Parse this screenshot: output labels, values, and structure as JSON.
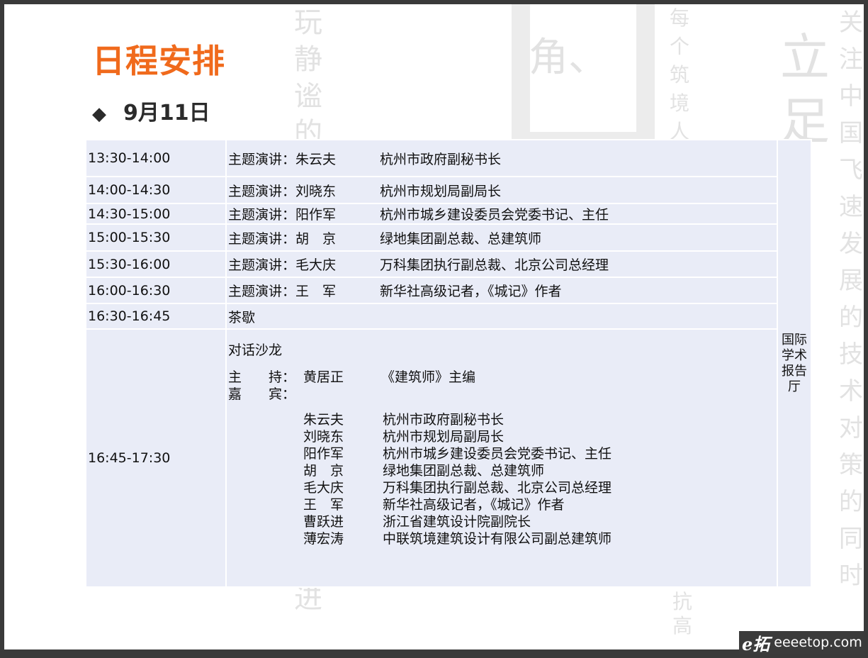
{
  "title": "日程安排",
  "date": "9月11日",
  "bullet": "◆",
  "venue": "国际学术报告厅",
  "rows": [
    {
      "time": "13:30-14:00",
      "speaker": "主题演讲：朱云夫",
      "role": "杭州市政府副秘书长"
    },
    {
      "time": "14:00-14:30",
      "speaker": "主题演讲：刘晓东",
      "role": "杭州市规划局副局长"
    },
    {
      "time": "14:30-15:00",
      "speaker": "主题演讲：阳作军",
      "role": "杭州市城乡建设委员会党委书记、主任"
    },
    {
      "time": "15:00-15:30",
      "speaker": "主题演讲：胡　京",
      "role": "绿地集团副总裁、总建筑师"
    },
    {
      "time": "15:30-16:00",
      "speaker": "主题演讲：毛大庆",
      "role": "万科集团执行副总裁、北京公司总经理"
    },
    {
      "time": "16:00-16:30",
      "speaker": "主题演讲：王　军",
      "role": "新华社高级记者，《城记》作者"
    },
    {
      "time": "16:30-16:45",
      "speaker": "茶歇",
      "role": ""
    }
  ],
  "salon": {
    "time": "16:45-17:30",
    "heading": "对话沙龙",
    "host_label": "主　　持：",
    "host_name": "黄居正",
    "host_role": "《建筑师》主编",
    "guest_label": "嘉　　宾：",
    "guests": [
      {
        "name": "朱云夫",
        "role": "杭州市政府副秘书长"
      },
      {
        "name": "刘晓东",
        "role": "杭州市规划局副局长"
      },
      {
        "name": "阳作军",
        "role": "杭州市城乡建设委员会党委书记、主任"
      },
      {
        "name": "胡　京",
        "role": "绿地集团副总裁、总建筑师"
      },
      {
        "name": "毛大庆",
        "role": "万科集团执行副总裁、北京公司总经理"
      },
      {
        "name": "王　军",
        "role": "新华社高级记者，《城记》作者"
      },
      {
        "name": "曹跃进",
        "role": "浙江省建筑设计院副院长"
      },
      {
        "name": "薄宏涛",
        "role": "中联筑境建筑设计有限公司副总建筑师"
      }
    ]
  },
  "watermark": {
    "logo": "e拓",
    "site": "eeeetop.com"
  },
  "bg_glyphs": [
    "玩静谧的",
    "角、",
    "每个筑境人",
    "立足",
    "关注中国飞速发展的技术对策的同时",
    "抗高",
    "进"
  ]
}
